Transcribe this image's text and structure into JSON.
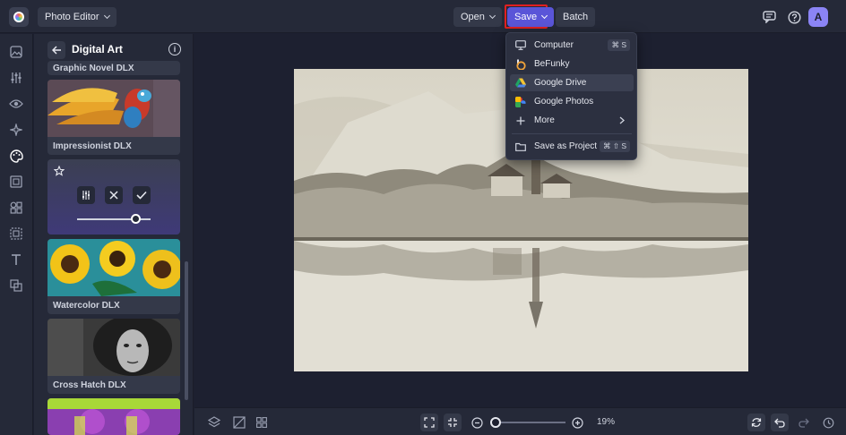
{
  "app": {
    "logo_icon": "befunky-logo-icon"
  },
  "topbar": {
    "mode_label": "Photo Editor",
    "open_label": "Open",
    "save_label": "Save",
    "batch_label": "Batch",
    "avatar_initial": "A",
    "icons": [
      "chat-icon",
      "help-icon"
    ]
  },
  "save_menu": {
    "items": [
      {
        "label": "Computer",
        "icon": "monitor-icon",
        "shortcut": "⌘ S"
      },
      {
        "label": "BeFunky",
        "icon": "befunky-icon",
        "shortcut": ""
      },
      {
        "label": "Google Drive",
        "icon": "google-drive-icon",
        "shortcut": ""
      },
      {
        "label": "Google Photos",
        "icon": "google-photos-icon",
        "shortcut": ""
      },
      {
        "label": "More",
        "icon": "plus-icon",
        "shortcut": ""
      },
      {
        "label": "Save as Project",
        "icon": "folder-icon",
        "shortcut": "⌘ ⇧ S"
      }
    ],
    "active_item": "Google Drive"
  },
  "panel": {
    "title": "Digital Art",
    "cards": [
      {
        "label": "Graphic Novel DLX"
      },
      {
        "label": "Impressionist DLX"
      },
      {
        "label": "Watercolor DLX"
      },
      {
        "label": "Cross Hatch DLX"
      }
    ],
    "active_card": {
      "slider_value": 0.8
    }
  },
  "bottombar": {
    "zoom_label": "19%",
    "zoom_value": 0.19
  },
  "colors": {
    "accent": "#5a55d8",
    "highlight_border": "#e02020",
    "avatar": "#8b84f5"
  }
}
